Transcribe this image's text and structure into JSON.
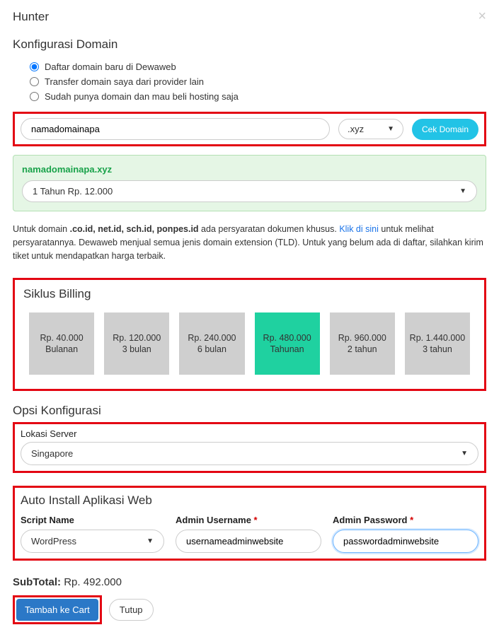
{
  "modal": {
    "title": "Hunter",
    "close": "×"
  },
  "domain": {
    "heading": "Konfigurasi Domain",
    "radios": {
      "r1": "Daftar domain baru di Dewaweb",
      "r2": "Transfer domain saya dari provider lain",
      "r3": "Sudah punya domain dan mau beli hosting saja"
    },
    "input_value": "namadomainapa",
    "tld": ".xyz",
    "check_btn": "Cek Domain",
    "result_name": "namadomainapa.xyz",
    "result_period": "1 Tahun Rp. 12.000",
    "note_prefix": "Untuk domain ",
    "note_bold": ".co.id, net.id, sch.id, ponpes.id",
    "note_mid": " ada persyaratan dokumen khusus. ",
    "note_link": "Klik di sini",
    "note_after": " untuk melihat persyaratannya. Dewaweb menjual semua jenis domain extension (TLD). Untuk yang belum ada di daftar, silahkan kirim tiket untuk mendapatkan harga terbaik."
  },
  "billing": {
    "heading": "Siklus Billing",
    "cycles": [
      {
        "price": "Rp. 40.000",
        "period": "Bulanan"
      },
      {
        "price": "Rp. 120.000",
        "period": "3 bulan"
      },
      {
        "price": "Rp. 240.000",
        "period": "6 bulan"
      },
      {
        "price": "Rp. 480.000",
        "period": "Tahunan"
      },
      {
        "price": "Rp. 960.000",
        "period": "2 tahun"
      },
      {
        "price": "Rp. 1.440.000",
        "period": "3 tahun"
      }
    ]
  },
  "opsi": {
    "heading": "Opsi Konfigurasi",
    "server_label": "Lokasi Server",
    "server_value": "Singapore"
  },
  "auto": {
    "heading": "Auto Install Aplikasi Web",
    "script_label": "Script Name",
    "script_value": "WordPress",
    "user_label": "Admin Username",
    "user_value": "usernameadminwebsite",
    "pass_label": "Admin Password",
    "pass_value": "passwordadminwebsite"
  },
  "footer": {
    "subtotal_label": "SubTotal:",
    "subtotal_value": "Rp. 492.000",
    "add": "Tambah ke Cart",
    "close": "Tutup"
  }
}
